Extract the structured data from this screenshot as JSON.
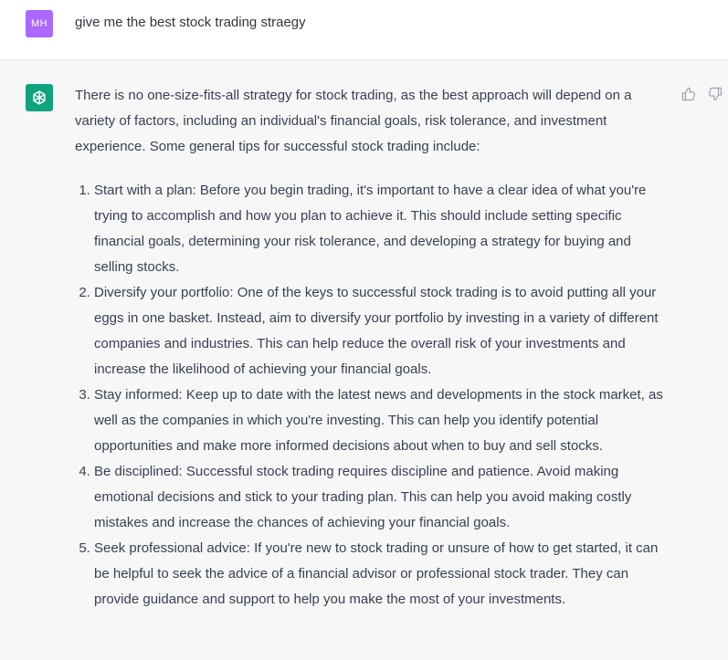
{
  "user_message": {
    "avatar_initials": "MH",
    "avatar_color": "#ab68ff",
    "text": "give me the best stock trading straegy"
  },
  "assistant_message": {
    "avatar_icon": "openai-logo-icon",
    "avatar_color": "#10a37f",
    "intro": "There is no one-size-fits-all strategy for stock trading, as the best approach will depend on a variety of factors, including an individual's financial goals, risk tolerance, and investment experience. Some general tips for successful stock trading include:",
    "items": [
      {
        "text": "Start with a plan: Before you begin trading, it's important to have a clear idea of what you're trying to accomplish and how you plan to achieve it. This should include setting specific financial goals, determining your risk tolerance, and developing a strategy for buying and selling stocks."
      },
      {
        "text": "Diversify your portfolio: One of the keys to successful stock trading is to avoid putting all your eggs in one basket. Instead, aim to diversify your portfolio by investing in a variety of different companies and industries. This can help reduce the overall risk of your investments and increase the likelihood of achieving your financial goals."
      },
      {
        "text": "Stay informed: Keep up to date with the latest news and developments in the stock market, as well as the companies in which you're investing. This can help you identify potential opportunities and make more informed decisions about when to buy and sell stocks."
      },
      {
        "text": "Be disciplined: Successful stock trading requires discipline and patience. Avoid making emotional decisions and stick to your trading plan. This can help you avoid making costly mistakes and increase the chances of achieving your financial goals."
      },
      {
        "text": "Seek professional advice: If you're new to stock trading or unsure of how to get started, it can be helpful to seek the advice of a financial advisor or professional stock trader. They can provide guidance and support to help you make the most of your investments."
      }
    ],
    "feedback": {
      "thumbs_up_icon": "thumbs-up-icon",
      "thumbs_down_icon": "thumbs-down-icon"
    }
  }
}
